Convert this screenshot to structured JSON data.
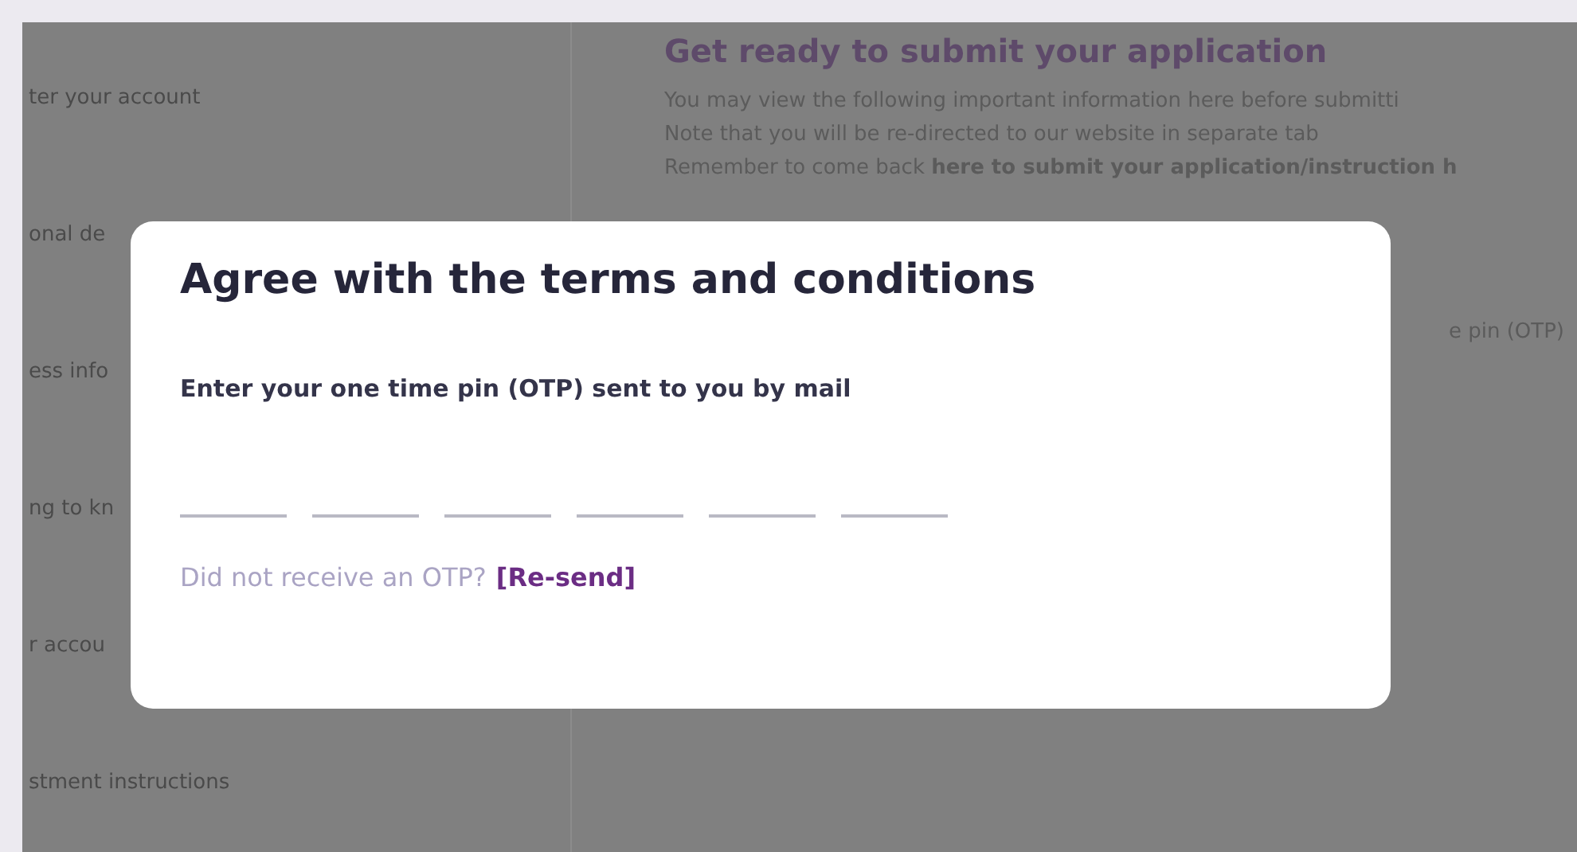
{
  "background": {
    "sidebar_items": [
      "ter your account",
      "onal de",
      "ess info",
      "ng to kn",
      "r accou",
      "stment instructions"
    ],
    "main": {
      "title": "Get ready to submit your application",
      "lines": [
        "You may view the following important information here before submitti",
        "Note that you will be re-directed to our website in separate tab",
        "Remember to come back **here to submit your application/instruction h**"
      ],
      "side_text": "e pin (OTP)"
    }
  },
  "dialog": {
    "title": "Agree with the terms and conditions",
    "prompt": "Enter your one time pin (OTP) sent to you by mail",
    "otp_fields": [
      {
        "kind": "digit"
      },
      {
        "kind": "digit"
      },
      {
        "kind": "digit"
      },
      {
        "kind": "digit"
      },
      {
        "kind": "digit"
      },
      {
        "kind": "digit"
      }
    ],
    "resend_question": "Did not receive an OTP?",
    "resend_link": "[Re-send]"
  }
}
